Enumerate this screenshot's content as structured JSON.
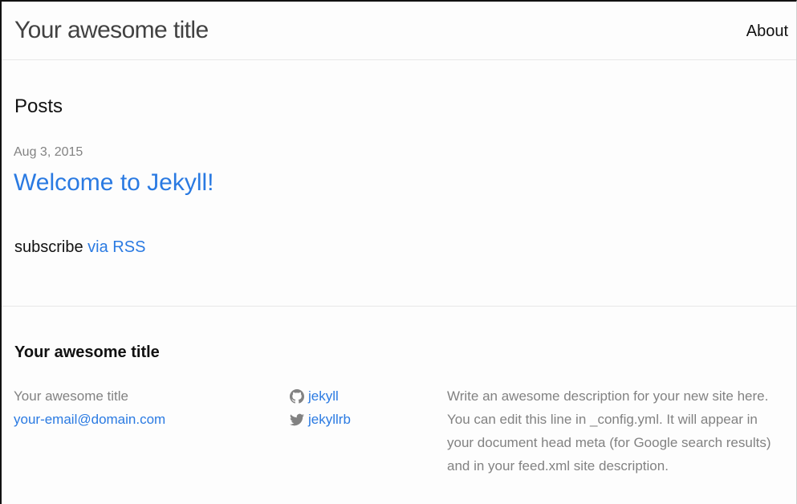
{
  "header": {
    "site_title": "Your awesome title",
    "nav": {
      "about": "About"
    }
  },
  "main": {
    "posts_heading": "Posts",
    "posts": [
      {
        "date": "Aug 3, 2015",
        "title": "Welcome to Jekyll!"
      }
    ],
    "subscribe": {
      "prefix": "subscribe",
      "link_label": "via RSS"
    }
  },
  "footer": {
    "heading": "Your awesome title",
    "owner_name": "Your awesome title",
    "email": "your-email@domain.com",
    "social": {
      "github": {
        "icon": "github-icon",
        "username": "jekyll"
      },
      "twitter": {
        "icon": "twitter-icon",
        "username": "jekyllrb"
      }
    },
    "description": "Write an awesome description for your new site here. You can edit this line in _config.yml. It will appear in your document head meta (for Google search results) and in your feed.xml site description."
  },
  "colors": {
    "link": "#2a7ae2",
    "text": "#111111",
    "muted": "#828282",
    "title": "#424242",
    "rule": "#e8e8e8",
    "background": "#fdfdfd"
  }
}
